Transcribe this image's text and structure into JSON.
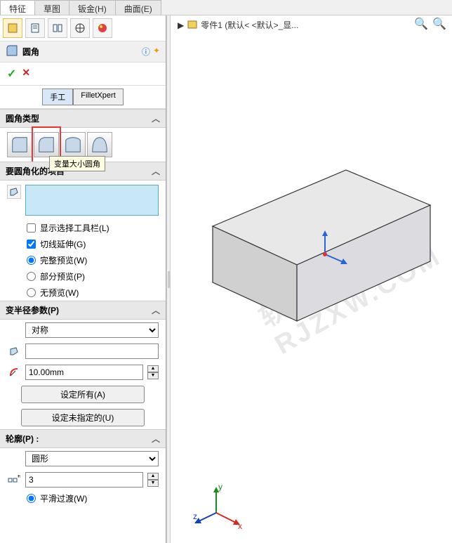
{
  "top_tabs": [
    "特征",
    "草图",
    "钣金(H)",
    "曲面(E)"
  ],
  "top_active": 0,
  "panel_tabs_active": 0,
  "command": {
    "title": "圆角",
    "help_icon": "?",
    "pin_icon": "📌"
  },
  "ok_cancel": {
    "ok": "✓",
    "cancel": "✕"
  },
  "mode": {
    "manual": "手工",
    "xpert": "FilletXpert",
    "active": "manual"
  },
  "sections": {
    "type": {
      "title": "圆角类型",
      "tooltip": "变量大小圆角"
    },
    "items": {
      "title": "要圆角化的项目",
      "show_toolbar": {
        "label": "显示选择工具栏(L)",
        "checked": false
      },
      "tangent": {
        "label": "切线延伸(G)",
        "checked": true
      },
      "preview_opts": [
        "完整预览(W)",
        "部分预览(P)",
        "无预览(W)"
      ],
      "preview_sel": 0
    },
    "params": {
      "title": "变半径参数(P)",
      "sym_label": "对称",
      "radius_val": "10.00mm",
      "set_all": "设定所有(A)",
      "set_unset": "设定未指定的(U)"
    },
    "profile": {
      "title": "轮廓(P) :",
      "shape": "圆形",
      "count": "3",
      "smooth": {
        "label": "平滑过渡(W)",
        "checked": true
      }
    }
  },
  "viewport": {
    "breadcrumb_arrow": "▶",
    "breadcrumb": "零件1  (默认< <默认>_显...",
    "triad": {
      "x": "x",
      "y": "y",
      "z": "z"
    }
  },
  "watermark": "软件自学网 RJZXW.COM",
  "chart_data": null
}
